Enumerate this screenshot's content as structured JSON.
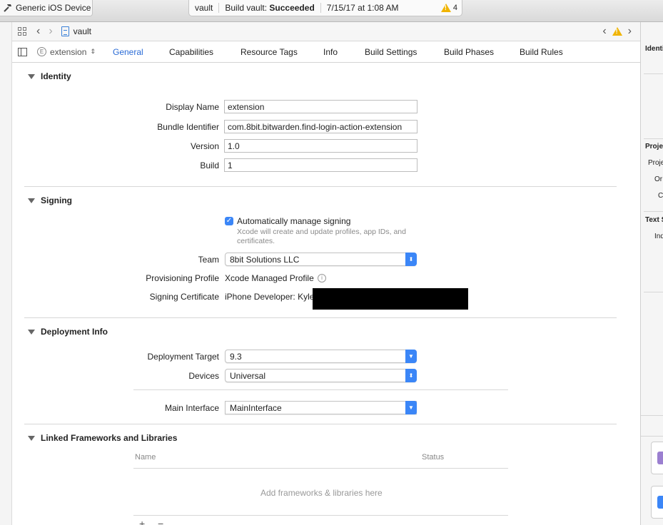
{
  "toolbar": {
    "scheme_device": "Generic iOS Device",
    "activity_project": "vault",
    "activity_status_prefix": "Build vault:",
    "activity_status_result": "Succeeded",
    "activity_timestamp": "7/15/17 at 1:08 AM",
    "warning_count": "4"
  },
  "jumpbar": {
    "file": "vault"
  },
  "tabbar": {
    "target": "extension",
    "tabs": [
      "General",
      "Capabilities",
      "Resource Tags",
      "Info",
      "Build Settings",
      "Build Phases",
      "Build Rules"
    ],
    "active_tab": "General"
  },
  "identity": {
    "title": "Identity",
    "display_name_label": "Display Name",
    "display_name": "extension",
    "bundle_id_label": "Bundle Identifier",
    "bundle_id": "com.8bit.bitwarden.find-login-action-extension",
    "version_label": "Version",
    "version": "1.0",
    "build_label": "Build",
    "build": "1"
  },
  "signing": {
    "title": "Signing",
    "auto_label": "Automatically manage signing",
    "auto_checked": true,
    "auto_hint": "Xcode will create and update profiles, app IDs, and certificates.",
    "team_label": "Team",
    "team": "8bit Solutions LLC",
    "profile_label": "Provisioning Profile",
    "profile": "Xcode Managed Profile",
    "cert_label": "Signing Certificate",
    "cert": "iPhone Developer: Kyle"
  },
  "deployment": {
    "title": "Deployment Info",
    "target_label": "Deployment Target",
    "target": "9.3",
    "devices_label": "Devices",
    "devices": "Universal",
    "main_interface_label": "Main Interface",
    "main_interface": "MainInterface"
  },
  "frameworks": {
    "title": "Linked Frameworks and Libraries",
    "col_name": "Name",
    "col_status": "Status",
    "placeholder": "Add frameworks & libraries here"
  },
  "inspector": {
    "identity": "Identi",
    "project": "Proje",
    "project_field": "Proje",
    "org": "Or",
    "class_prefix": "C",
    "text_settings": "Text S",
    "indent": "Ind"
  },
  "colors": {
    "accent": "#3b86f7",
    "tab_active": "#2a6bd6",
    "warning": "#f0b400"
  }
}
